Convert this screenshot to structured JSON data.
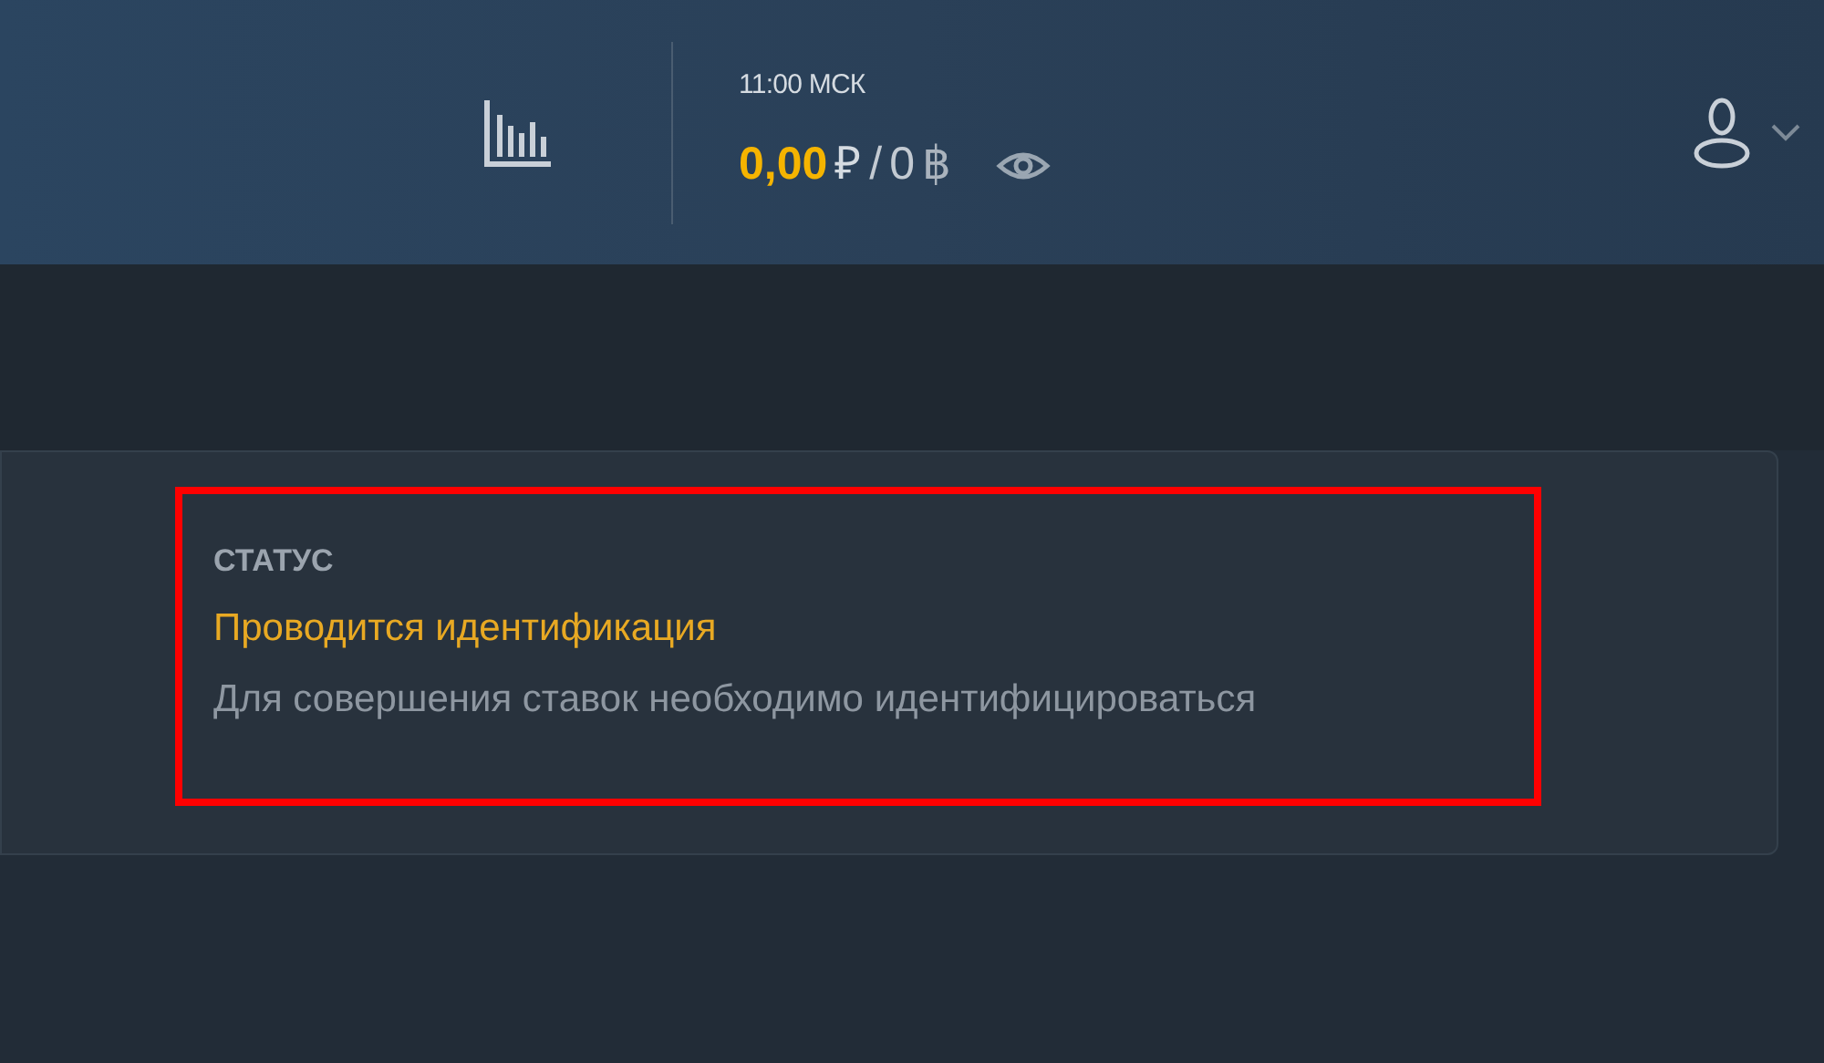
{
  "header": {
    "time": "11:00 МСК",
    "balance": {
      "amount": "0,00",
      "currency": "₽",
      "separator": "/",
      "bonus": "0",
      "bonus_currency": "฿"
    }
  },
  "status": {
    "label": "СТАТУС",
    "title": "Проводится идентификация",
    "message": "Для совершения ставок необходимо идентифицироваться",
    "highlighted": true
  }
}
